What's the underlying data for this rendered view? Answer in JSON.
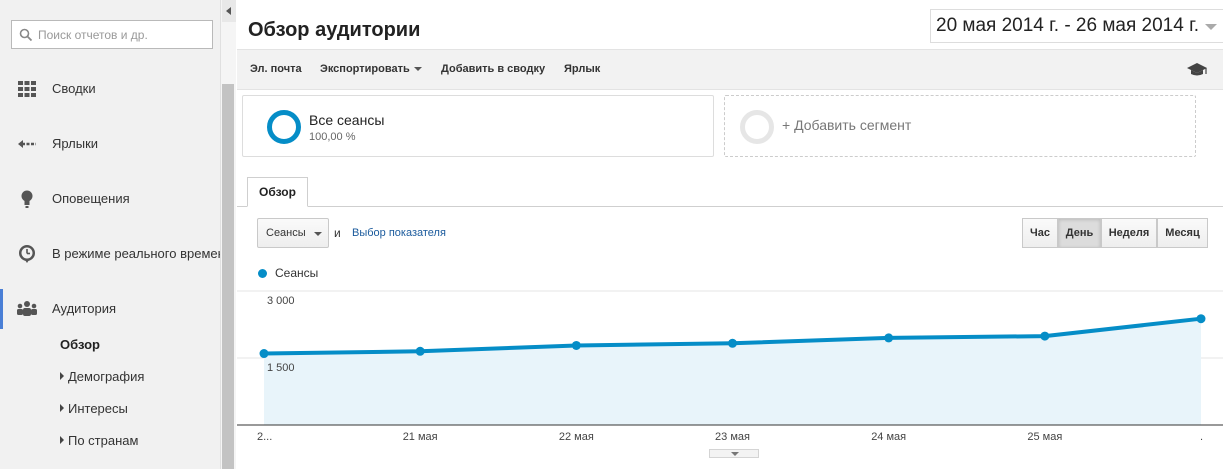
{
  "sidebar": {
    "search_placeholder": "Поиск отчетов и др.",
    "items": [
      {
        "label": "Сводки",
        "icon": "grid-icon"
      },
      {
        "label": "Ярлыки",
        "icon": "shortcut-arrow-icon"
      },
      {
        "label": "Оповещения",
        "icon": "lightbulb-icon"
      },
      {
        "label": "В режиме реального времени",
        "icon": "clock-icon"
      },
      {
        "label": "Аудитория",
        "icon": "people-icon"
      }
    ],
    "sub_items": [
      {
        "label": "Обзор"
      },
      {
        "label": "Демография"
      },
      {
        "label": "Интересы"
      },
      {
        "label": "По странам"
      }
    ],
    "active_accent": "#4a7fd6"
  },
  "header": {
    "title": "Обзор аудитории",
    "date_range": "20 мая 2014 г. - 26 мая 2014 г."
  },
  "toolbar": {
    "email": "Эл. почта",
    "export": "Экспортировать",
    "add_to_dashboard": "Добавить в сводку",
    "shortcut": "Ярлык",
    "icon": "graduation-cap-icon"
  },
  "segments": {
    "active": {
      "name": "Все сеансы",
      "percent": "100,00 %"
    },
    "add_label": "+ Добавить сегмент"
  },
  "tabs": [
    {
      "label": "Обзор"
    }
  ],
  "controls": {
    "metric": "Сеансы",
    "and_text": "и",
    "pick_metric": "Выбор показателя",
    "granularity": [
      "Час",
      "День",
      "Неделя",
      "Месяц"
    ],
    "active_granularity": "День"
  },
  "colors": {
    "series": "#058dc7",
    "area": "#e8f4fa"
  },
  "chart_data": {
    "type": "area",
    "x": [
      "2...",
      "21 мая",
      "22 мая",
      "23 мая",
      "24 мая",
      "25 мая",
      "."
    ],
    "series": [
      {
        "name": "Сеансы",
        "values": [
          1600,
          1650,
          1780,
          1830,
          1950,
          1990,
          2380
        ]
      }
    ],
    "yticks": [
      "3 000",
      "1 500"
    ],
    "ylim": [
      0,
      3000
    ],
    "legend": "top-left"
  }
}
